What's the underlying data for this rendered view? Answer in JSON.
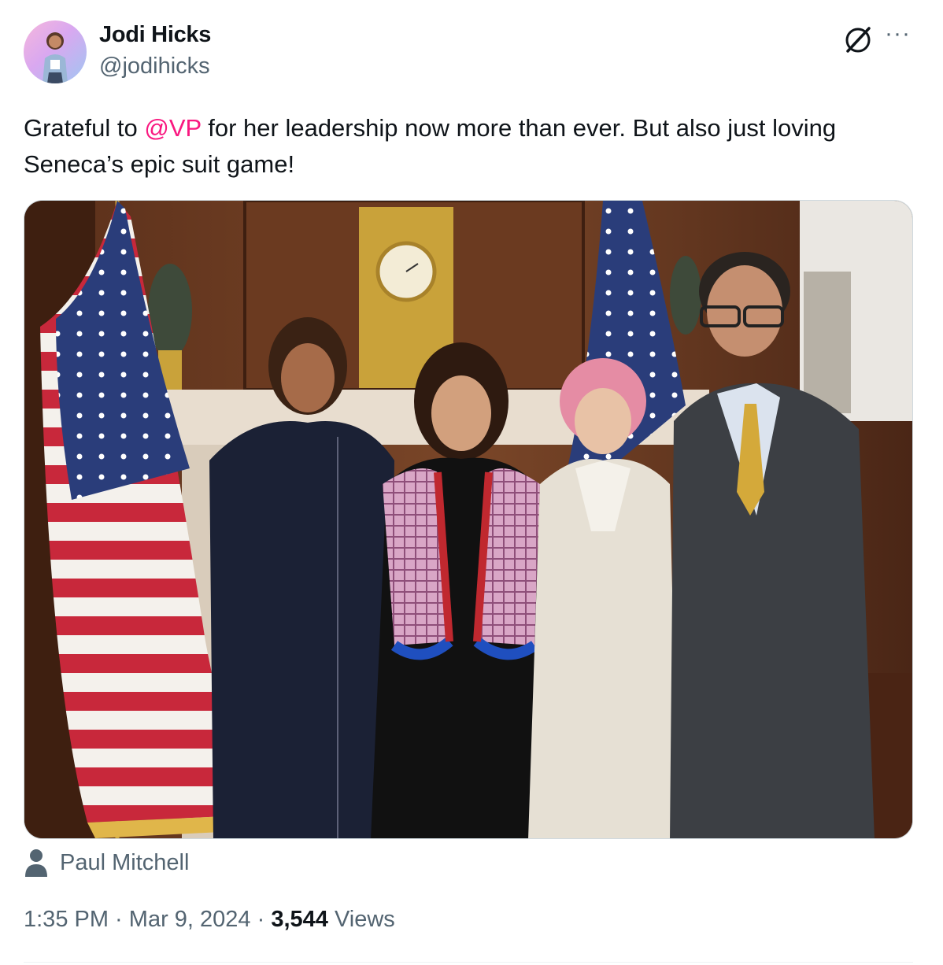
{
  "author": {
    "name": "Jodi Hicks",
    "handle": "@jodihicks",
    "avatar_icon": "profile-photo"
  },
  "header_icons": {
    "grok": "grok-icon",
    "more": "more-options-icon",
    "more_glyph": "···"
  },
  "tweet": {
    "text_before": "Grateful to ",
    "mention": "@VP",
    "text_after": " for her leadership now more than ever. But also just loving Seneca’s epic suit game!",
    "mention_color": "#f91880"
  },
  "media": {
    "type": "photo",
    "tagged_icon": "person-icon",
    "tagged_person": "Paul Mitchell"
  },
  "meta": {
    "time": "1:35 PM",
    "separator": " · ",
    "date": "Mar 9, 2024",
    "views_count": "3,544",
    "views_label": " Views"
  },
  "colors": {
    "text_primary": "#0f1419",
    "text_secondary": "#536471",
    "border": "#cfd9de"
  }
}
